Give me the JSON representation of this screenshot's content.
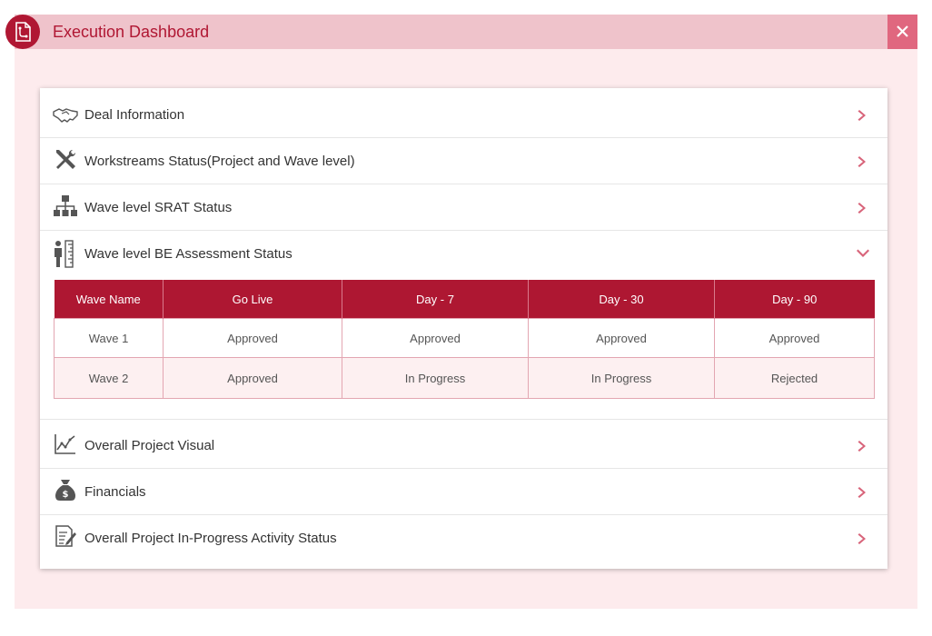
{
  "header": {
    "title": "Execution Dashboard",
    "close_icon": "close-icon",
    "logo_icon": "document-icon",
    "accent": "#b01733"
  },
  "sections": [
    {
      "label": "Deal Information",
      "icon": "handshake-icon",
      "expanded": false
    },
    {
      "label": "Workstreams Status(Project and Wave level)",
      "icon": "tools-icon",
      "expanded": false
    },
    {
      "label": "Wave level SRAT Status",
      "icon": "hierarchy-icon",
      "expanded": false
    },
    {
      "label": "Wave level BE Assessment Status",
      "icon": "measure-person-icon",
      "expanded": true
    },
    {
      "label": "Overall Project Visual",
      "icon": "line-chart-icon",
      "expanded": false
    },
    {
      "label": "Financials",
      "icon": "money-bag-icon",
      "expanded": false
    },
    {
      "label": "Overall Project In-Progress Activity Status",
      "icon": "report-icon",
      "expanded": false
    }
  ],
  "be_table": {
    "columns": [
      "Wave Name",
      "Go Live",
      "Day - 7",
      "Day - 30",
      "Day - 90"
    ],
    "rows": [
      [
        "Wave 1",
        "Approved",
        "Approved",
        "Approved",
        "Approved"
      ],
      [
        "Wave 2",
        "Approved",
        "In Progress",
        "In Progress",
        "Rejected"
      ]
    ]
  }
}
